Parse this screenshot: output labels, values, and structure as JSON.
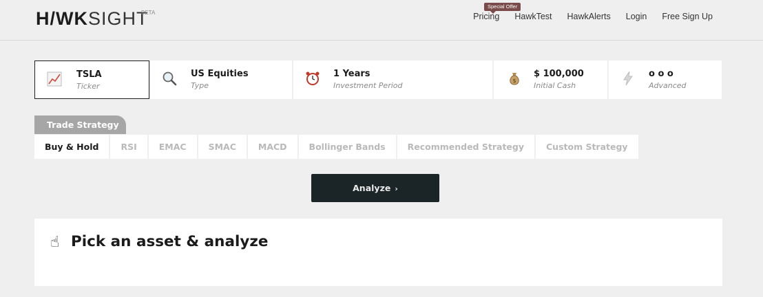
{
  "header": {
    "logo_hawk": "H/WK",
    "logo_sight": "SIGHT",
    "logo_badge": "BETA",
    "offer_badge": "Special Offer",
    "nav": [
      "Pricing",
      "HawkTest",
      "HawkAlerts",
      "Login",
      "Free Sign Up"
    ]
  },
  "params": [
    {
      "value": "TSLA",
      "label": "Ticker",
      "icon": "chart-line-icon",
      "active": true
    },
    {
      "value": "US Equities",
      "label": "Type",
      "icon": "magnifier-icon"
    },
    {
      "value": "1 Years",
      "label": "Investment Period",
      "icon": "alarm-clock-icon"
    },
    {
      "value": "$ 100,000",
      "label": "Initial Cash",
      "icon": "money-bag-icon"
    },
    {
      "value": "o o o",
      "label": "Advanced",
      "icon": "lightning-icon"
    }
  ],
  "strategy": {
    "heading": "Trade Strategy",
    "options": [
      "Buy & Hold",
      "RSI",
      "EMAC",
      "SMAC",
      "MACD",
      "Bollinger Bands",
      "Recommended Strategy",
      "Custom Strategy"
    ],
    "selected": "Buy & Hold"
  },
  "analyze_button": {
    "label": "Analyze",
    "chevron": "›"
  },
  "result": {
    "hand_icon": "☝",
    "title": "Pick an asset & analyze"
  },
  "colors": {
    "background": "#efefef",
    "button": "#1b2426",
    "offer": "#7a4b4b",
    "tab": "#a6a6a6"
  }
}
